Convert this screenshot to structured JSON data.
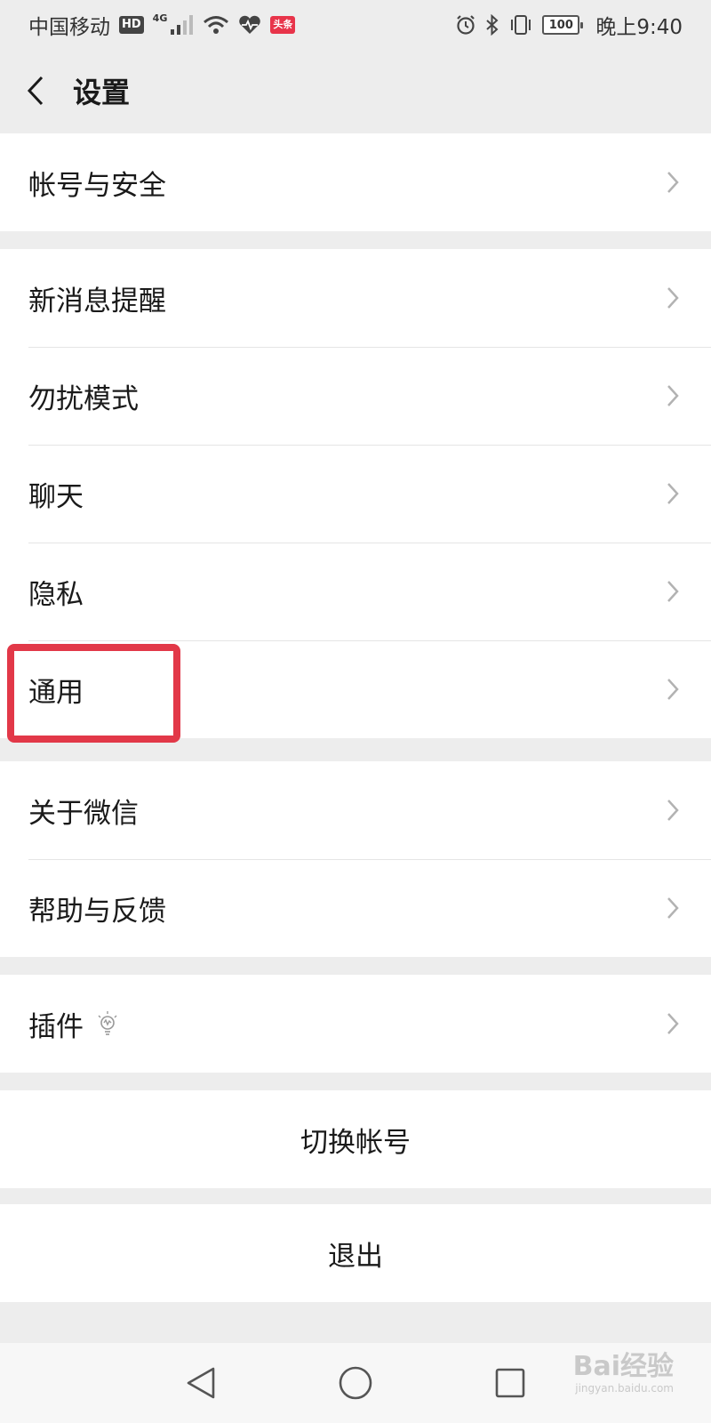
{
  "status_bar": {
    "carrier": "中国移动",
    "hd": "HD",
    "network": "4G",
    "toutiao": "头条",
    "battery": "100",
    "time": "晚上9:40",
    "icons": [
      "signal-icon",
      "wifi-icon",
      "health-heart-icon",
      "alarm-icon",
      "bluetooth-icon",
      "vibrate-icon",
      "battery-icon"
    ]
  },
  "header": {
    "title": "设置"
  },
  "groups": [
    {
      "items": [
        {
          "label": "帐号与安全"
        }
      ]
    },
    {
      "items": [
        {
          "label": "新消息提醒"
        },
        {
          "label": "勿扰模式"
        },
        {
          "label": "聊天"
        },
        {
          "label": "隐私"
        },
        {
          "label": "通用",
          "highlighted": true
        }
      ]
    },
    {
      "items": [
        {
          "label": "关于微信"
        },
        {
          "label": "帮助与反馈"
        }
      ]
    },
    {
      "items": [
        {
          "label": "插件",
          "icon": "lightbulb-icon"
        }
      ]
    }
  ],
  "actions": {
    "switch_account": "切换帐号",
    "logout": "退出"
  },
  "watermark": {
    "main": "Bai经验",
    "sub": "jingyan.baidu.com"
  },
  "colors": {
    "background": "#ededed",
    "highlight": "#e23848",
    "text": "#1a1a1a",
    "chevron": "#b2b2b2"
  }
}
